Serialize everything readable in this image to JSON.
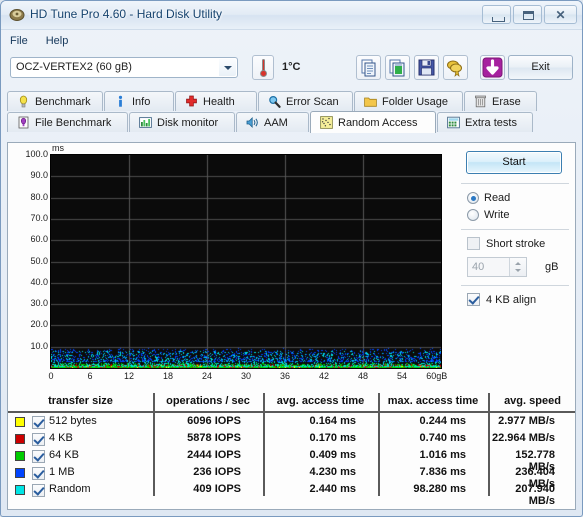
{
  "window": {
    "title": "HD Tune Pro 4.60 - Hard Disk Utility",
    "icon": "app-icon",
    "minimize": "minimize",
    "maximize": "maximize",
    "close": "✕"
  },
  "menu": {
    "items": [
      "File",
      "Help"
    ]
  },
  "toolbar": {
    "drive_selected": "OCZ-VERTEX2 (60 gB)",
    "temperature": "1°C",
    "buttons": [
      {
        "name": "copy-icon",
        "label": ""
      },
      {
        "name": "copy-image-icon",
        "label": ""
      },
      {
        "name": "save-icon",
        "label": ""
      },
      {
        "name": "certificate-icon",
        "label": ""
      },
      {
        "name": "download-icon",
        "label": ""
      }
    ],
    "exit_label": "Exit"
  },
  "tabs": {
    "row1": [
      {
        "label": "Benchmark",
        "icon": "lightbulb-icon",
        "active": false
      },
      {
        "label": "Info",
        "icon": "info-icon",
        "active": false
      },
      {
        "label": "Health",
        "icon": "redcross-icon",
        "active": false
      },
      {
        "label": "Error Scan",
        "icon": "magnifier-icon",
        "active": false
      },
      {
        "label": "Folder Usage",
        "icon": "folder-icon",
        "active": false
      },
      {
        "label": "Erase",
        "icon": "trash-icon",
        "active": false
      }
    ],
    "row2": [
      {
        "label": "File Benchmark",
        "icon": "file-benchmark-icon",
        "active": false
      },
      {
        "label": "Disk monitor",
        "icon": "bars-icon",
        "active": false
      },
      {
        "label": "AAM",
        "icon": "speaker-icon",
        "active": false
      },
      {
        "label": "Random Access",
        "icon": "scatter-icon",
        "active": true
      },
      {
        "label": "Extra tests",
        "icon": "calculator-icon",
        "active": false
      }
    ]
  },
  "controls": {
    "start_label": "Start",
    "mode": {
      "read_label": "Read",
      "write_label": "Write",
      "selected": "Read"
    },
    "short_stroke": {
      "label": "Short stroke",
      "checked": false,
      "value": "40",
      "unit": "gB"
    },
    "align": {
      "label": "4 KB align",
      "checked": true
    }
  },
  "chart_data": {
    "type": "scatter",
    "title": "",
    "ylabel": "ms",
    "xlabel": "gB",
    "ylim": [
      0,
      100
    ],
    "xlim": [
      0,
      60
    ],
    "yticks": [
      "100.0",
      "90.0",
      "80.0",
      "70.0",
      "60.0",
      "50.0",
      "40.0",
      "30.0",
      "20.0",
      "10.0"
    ],
    "ytick_values": [
      100,
      90,
      80,
      70,
      60,
      50,
      40,
      30,
      20,
      10
    ],
    "xticks": [
      "0",
      "6",
      "12",
      "18",
      "24",
      "30",
      "36",
      "42",
      "48",
      "54",
      "60gB"
    ],
    "xtick_values": [
      0,
      6,
      12,
      18,
      24,
      30,
      36,
      42,
      48,
      54,
      60
    ],
    "grid": true,
    "background": "#0b0b0b",
    "series": [
      {
        "name": "512 bytes",
        "color": "#ffff00",
        "y_range": [
          0.1,
          1.0
        ]
      },
      {
        "name": "4 KB",
        "color": "#cc0000",
        "y_range": [
          0.1,
          1.5
        ]
      },
      {
        "name": "64 KB",
        "color": "#00cc00",
        "y_range": [
          0.2,
          2.0
        ]
      },
      {
        "name": "1 MB",
        "color": "#0044ff",
        "y_range": [
          3.0,
          9.0
        ]
      },
      {
        "name": "Random",
        "color": "#00e5e5",
        "y_range": [
          0.5,
          8.0
        ]
      }
    ]
  },
  "table": {
    "headers": [
      "transfer size",
      "operations / sec",
      "avg. access time",
      "max. access time",
      "avg. speed"
    ],
    "rows": [
      {
        "color": "#ffff00",
        "checked": true,
        "size": "512 bytes",
        "iops": "6096 IOPS",
        "avg_access": "0.164 ms",
        "max_access": "0.244 ms",
        "avg_speed": "2.977 MB/s"
      },
      {
        "color": "#cc0000",
        "checked": true,
        "size": "4 KB",
        "iops": "5878 IOPS",
        "avg_access": "0.170 ms",
        "max_access": "0.740 ms",
        "avg_speed": "22.964 MB/s"
      },
      {
        "color": "#00cc00",
        "checked": true,
        "size": "64 KB",
        "iops": "2444 IOPS",
        "avg_access": "0.409 ms",
        "max_access": "1.016 ms",
        "avg_speed": "152.778 MB/s"
      },
      {
        "color": "#0044ff",
        "checked": true,
        "size": "1 MB",
        "iops": "236 IOPS",
        "avg_access": "4.230 ms",
        "max_access": "7.836 ms",
        "avg_speed": "236.404 MB/s"
      },
      {
        "color": "#00e5e5",
        "checked": true,
        "size": "Random",
        "iops": "409 IOPS",
        "avg_access": "2.440 ms",
        "max_access": "98.280 ms",
        "avg_speed": "207.940 MB/s"
      }
    ]
  }
}
